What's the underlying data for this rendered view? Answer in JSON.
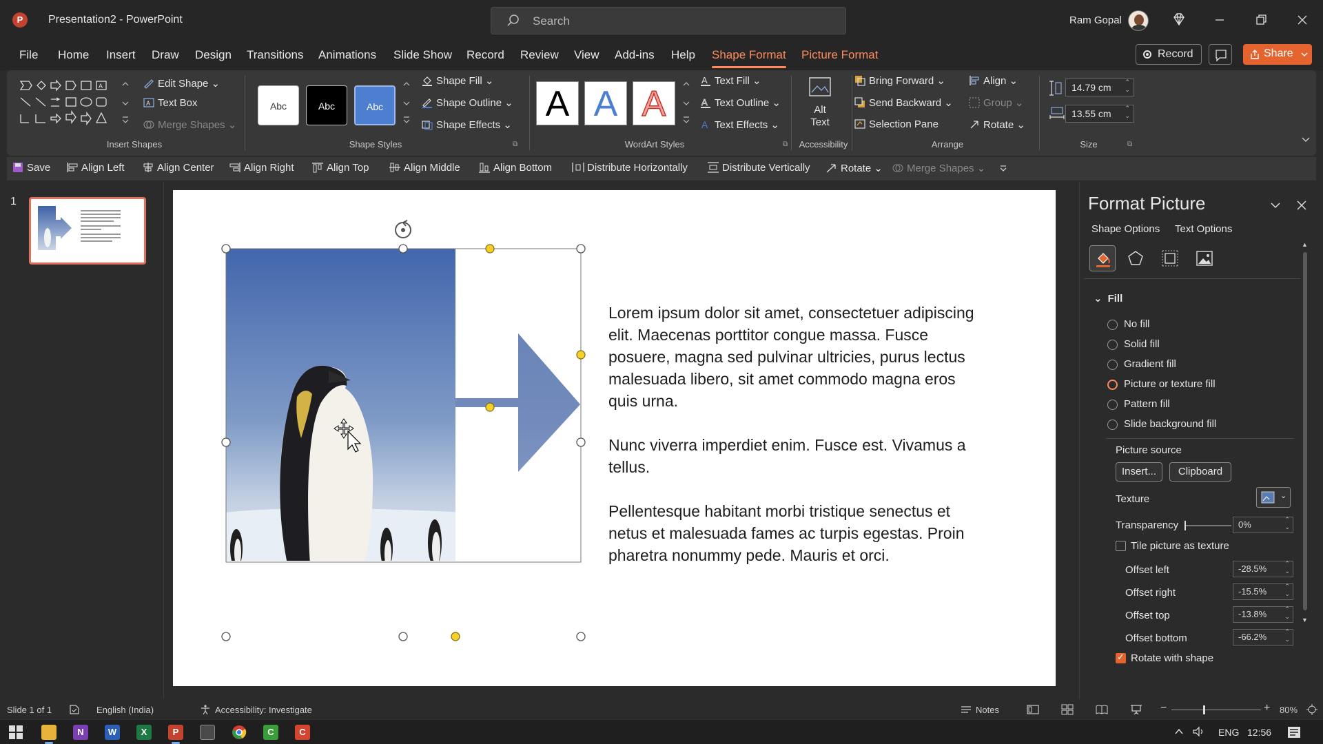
{
  "titlebar": {
    "doc_title": "Presentation2  -  PowerPoint",
    "search_placeholder": "Search",
    "user_name": "Ram Gopal"
  },
  "tabs": [
    "File",
    "Home",
    "Insert",
    "Draw",
    "Design",
    "Transitions",
    "Animations",
    "Slide Show",
    "Record",
    "Review",
    "View",
    "Add-ins",
    "Help",
    "Shape Format",
    "Picture Format"
  ],
  "active_tab": "Shape Format",
  "top_buttons": {
    "record": "Record",
    "share": "Share"
  },
  "ribbon": {
    "insert_shapes": {
      "edit_shape": "Edit Shape",
      "text_box": "Text Box",
      "merge_shapes": "Merge Shapes",
      "label": "Insert Shapes"
    },
    "shape_styles": {
      "style_labels": [
        "Abc",
        "Abc",
        "Abc"
      ],
      "fill": "Shape Fill",
      "outline": "Shape Outline",
      "effects": "Shape Effects",
      "label": "Shape Styles"
    },
    "wordart": {
      "letters": [
        "A",
        "A",
        "A"
      ],
      "text_fill": "Text Fill",
      "text_outline": "Text Outline",
      "text_effects": "Text Effects",
      "label": "WordArt Styles"
    },
    "accessibility": {
      "alt_text_line1": "Alt",
      "alt_text_line2": "Text",
      "label": "Accessibility"
    },
    "arrange": {
      "bring_forward": "Bring Forward",
      "send_backward": "Send Backward",
      "selection_pane": "Selection Pane",
      "align": "Align",
      "group": "Group",
      "rotate": "Rotate",
      "label": "Arrange"
    },
    "size": {
      "height": "14.79 cm",
      "width": "13.55 cm",
      "label": "Size"
    }
  },
  "qat": [
    "Save",
    "Align Left",
    "Align Center",
    "Align Right",
    "Align Top",
    "Align Middle",
    "Align Bottom",
    "Distribute Horizontally",
    "Distribute Vertically",
    "Rotate",
    "Merge Shapes"
  ],
  "thumbnails": {
    "slide_number": "1"
  },
  "slide": {
    "paragraphs": [
      "Lorem ipsum dolor sit amet, consectetuer adipiscing elit. Maecenas porttitor congue massa. Fusce posuere, magna sed pulvinar ultricies, purus lectus malesuada libero, sit amet commodo magna eros quis urna.",
      "Nunc viverra imperdiet enim. Fusce est. Vivamus a tellus.",
      "Pellentesque habitant morbi tristique senectus et netus et malesuada fames ac turpis egestas. Proin pharetra nonummy pede. Mauris et orci."
    ]
  },
  "format_pane": {
    "title": "Format Picture",
    "tab_shape_options": "Shape Options",
    "tab_text_options": "Text Options",
    "fill_header": "Fill",
    "fill_options": [
      "No fill",
      "Solid fill",
      "Gradient fill",
      "Picture or texture fill",
      "Pattern fill",
      "Slide background fill"
    ],
    "selected_fill": "Picture or texture fill",
    "picture_source": "Picture source",
    "insert_btn": "Insert...",
    "clipboard_btn": "Clipboard",
    "texture": "Texture",
    "transparency": "Transparency",
    "transparency_value": "0%",
    "tile_picture": "Tile picture as texture",
    "tile_checked": false,
    "offset_left": "Offset left",
    "offset_left_value": "-28.5%",
    "offset_right": "Offset right",
    "offset_right_value": "-15.5%",
    "offset_top": "Offset top",
    "offset_top_value": "-13.8%",
    "offset_bottom": "Offset bottom",
    "offset_bottom_value": "-66.2%",
    "rotate_with_shape": "Rotate with shape",
    "rotate_checked": true
  },
  "statusbar": {
    "slide_info": "Slide 1 of 1",
    "language": "English (India)",
    "accessibility": "Accessibility: Investigate",
    "notes": "Notes",
    "zoom": "80%"
  },
  "taskbar": {
    "lang": "ENG",
    "time": "12:56"
  },
  "colors": {
    "accent": "#ff8a5b",
    "share": "#e5632e",
    "arrow_fill": "#6f86b8"
  }
}
